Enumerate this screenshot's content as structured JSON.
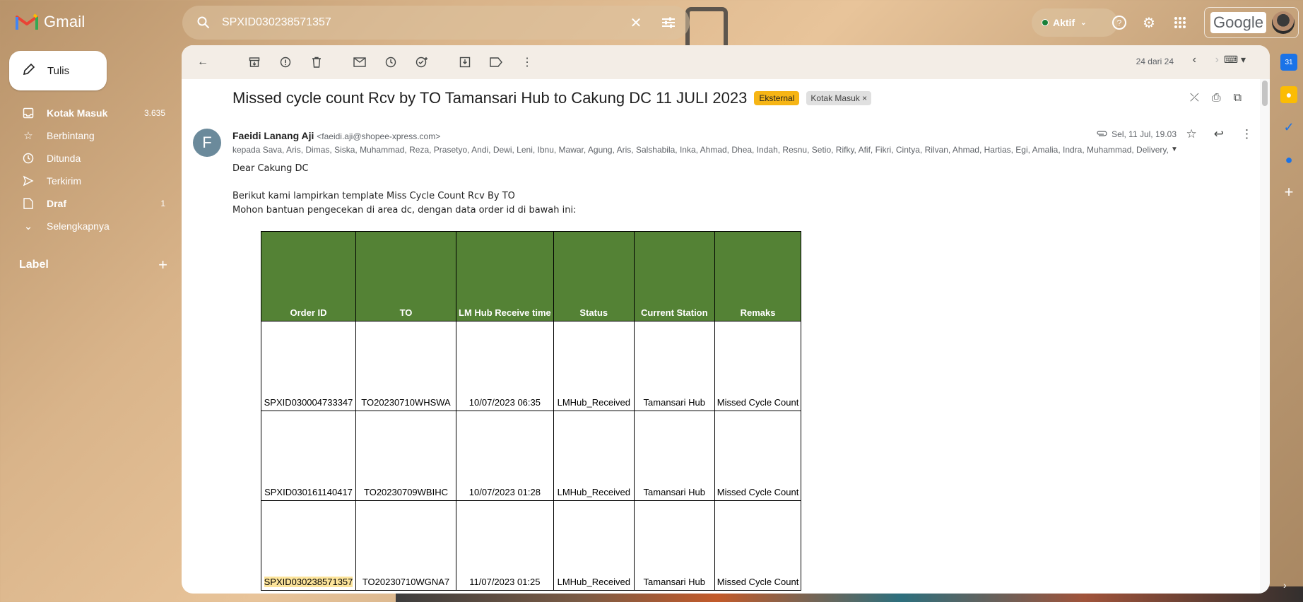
{
  "app": {
    "name": "Gmail",
    "google_label": "Google"
  },
  "search": {
    "value": "SPXID030238571357"
  },
  "status": {
    "label": "Aktif",
    "color": "#188038"
  },
  "compose": {
    "label": "Tulis"
  },
  "sidebar": {
    "items": [
      {
        "label": "Kotak Masuk",
        "count": "3.635",
        "icon": "inbox-icon",
        "bold": true
      },
      {
        "label": "Berbintang",
        "count": "",
        "icon": "star-icon",
        "bold": false
      },
      {
        "label": "Ditunda",
        "count": "",
        "icon": "clock-icon",
        "bold": false
      },
      {
        "label": "Terkirim",
        "count": "",
        "icon": "send-icon",
        "bold": false
      },
      {
        "label": "Draf",
        "count": "1",
        "icon": "draft-icon",
        "bold": true
      },
      {
        "label": "Selengkapnya",
        "count": "",
        "icon": "chevron-down-icon",
        "bold": false
      }
    ],
    "label_heading": "Label"
  },
  "toolbar": {
    "pager": "24 dari 24"
  },
  "email": {
    "subject": "Missed cycle count Rcv by TO Tamansari Hub to Cakung DC 11 JULI 2023",
    "tag_external": "Eksternal",
    "tag_inbox": "Kotak Masuk",
    "sender_initial": "F",
    "sender_name": "Faeidi Lanang Aji",
    "sender_email": "<faeidi.aji@shopee-xpress.com>",
    "date": "Sel, 11 Jul, 19.03",
    "recipients": "kepada Sava, Aris, Dimas, Siska, Muhammad, Reza, Prasetyo, Andi, Dewi, Leni, Ibnu, Mawar, Agung, Aris, Salshabila, Inka, Ahmad, Dhea, Indah, Resnu, Setio, Rifky, Afif, Fikri, Cintya, Rilvan, Ahmad, Hartias, Egi, Amalia, Indra, Muhammad, Delivery,",
    "greeting": "Dear Cakung DC",
    "line1": "Berikut kami lampirkan template Miss Cycle Count Rcv By TO",
    "line2": "Mohon bantuan pengecekan di area dc, dengan data order id di bawah ini:"
  },
  "table": {
    "headers": [
      "Order ID",
      "TO",
      "LM Hub Receive time",
      "Status",
      "Current Station",
      "Remaks"
    ],
    "rows": [
      [
        "SPXID030004733347",
        "TO20230710WHSWA",
        "10/07/2023 06:35",
        "LMHub_Received",
        "Tamansari Hub",
        "Missed Cycle Count"
      ],
      [
        "SPXID030161140417",
        "TO20230709WBIHC",
        "10/07/2023 01:28",
        "LMHub_Received",
        "Tamansari Hub",
        "Missed Cycle Count"
      ],
      [
        "SPXID030238571357",
        "TO20230710WGNA7",
        "11/07/2023 01:25",
        "LMHub_Received",
        "Tamansari Hub",
        "Missed Cycle Count"
      ]
    ],
    "header_color": "#548235",
    "highlight_color": "#fce49b"
  }
}
